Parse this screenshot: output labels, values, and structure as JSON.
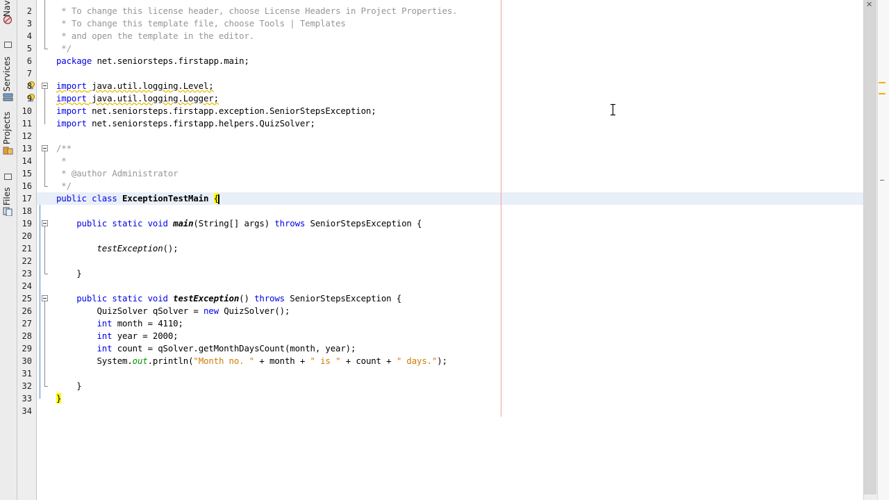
{
  "sidebar": {
    "tabs": [
      {
        "label": "Navigator"
      },
      {
        "label": "Services"
      },
      {
        "label": "Projects"
      },
      {
        "label": "Files"
      }
    ]
  },
  "editor": {
    "current_line": 17,
    "lines": [
      {
        "n": "2",
        "segs": [
          {
            "t": " * To change this license header, choose License Headers in Project Properties.",
            "c": "cm"
          }
        ]
      },
      {
        "n": "3",
        "segs": [
          {
            "t": " * To change this template file, choose Tools | Templates",
            "c": "cm"
          }
        ]
      },
      {
        "n": "4",
        "segs": [
          {
            "t": " * and open the template in the editor.",
            "c": "cm"
          }
        ]
      },
      {
        "n": "5",
        "segs": [
          {
            "t": " */",
            "c": "cm"
          }
        ]
      },
      {
        "n": "6",
        "segs": [
          {
            "t": "package",
            "c": "kw"
          },
          {
            "t": " net.seniorsteps.firstapp.main;",
            "c": ""
          }
        ]
      },
      {
        "n": "7",
        "segs": []
      },
      {
        "n": "8",
        "segs": [
          {
            "t": "import",
            "c": "kw warnul"
          },
          {
            "t": " java.util.logging.Level;",
            "c": "warnul"
          }
        ]
      },
      {
        "n": "9",
        "segs": [
          {
            "t": "import",
            "c": "kw warnul"
          },
          {
            "t": " java.util.logging.Logger;",
            "c": "warnul"
          }
        ]
      },
      {
        "n": "10",
        "segs": [
          {
            "t": "import",
            "c": "kw"
          },
          {
            "t": " net.seniorsteps.firstapp.exception.SeniorStepsException;",
            "c": ""
          }
        ]
      },
      {
        "n": "11",
        "segs": [
          {
            "t": "import",
            "c": "kw"
          },
          {
            "t": " net.seniorsteps.firstapp.helpers.QuizSolver;",
            "c": ""
          }
        ]
      },
      {
        "n": "12",
        "segs": []
      },
      {
        "n": "13",
        "segs": [
          {
            "t": "/**",
            "c": "cm"
          }
        ]
      },
      {
        "n": "14",
        "segs": [
          {
            "t": " *",
            "c": "cm"
          }
        ]
      },
      {
        "n": "15",
        "segs": [
          {
            "t": " * @author Administrator",
            "c": "cm"
          }
        ]
      },
      {
        "n": "16",
        "segs": [
          {
            "t": " */",
            "c": "cm"
          }
        ]
      },
      {
        "n": "17",
        "segs": [
          {
            "t": "public class",
            "c": "kw"
          },
          {
            "t": " ",
            "c": ""
          },
          {
            "t": "ExceptionTestMain",
            "c": "bold"
          },
          {
            "t": " ",
            "c": ""
          },
          {
            "t": "{",
            "c": "brace-hl"
          },
          {
            "caret": true
          }
        ]
      },
      {
        "n": "18",
        "segs": []
      },
      {
        "n": "19",
        "segs": [
          {
            "t": "    public static void",
            "c": "kw"
          },
          {
            "t": " ",
            "c": ""
          },
          {
            "t": "main",
            "c": "it bold"
          },
          {
            "t": "(String[] args) ",
            "c": ""
          },
          {
            "t": "throws",
            "c": "kw"
          },
          {
            "t": " SeniorStepsException {",
            "c": ""
          }
        ]
      },
      {
        "n": "20",
        "segs": []
      },
      {
        "n": "21",
        "segs": [
          {
            "t": "        ",
            "c": ""
          },
          {
            "t": "testException",
            "c": "it"
          },
          {
            "t": "();",
            "c": ""
          }
        ]
      },
      {
        "n": "22",
        "segs": []
      },
      {
        "n": "23",
        "segs": [
          {
            "t": "    }",
            "c": ""
          }
        ]
      },
      {
        "n": "24",
        "segs": []
      },
      {
        "n": "25",
        "segs": [
          {
            "t": "    public static void",
            "c": "kw"
          },
          {
            "t": " ",
            "c": ""
          },
          {
            "t": "testException",
            "c": "it bold"
          },
          {
            "t": "() ",
            "c": ""
          },
          {
            "t": "throws",
            "c": "kw"
          },
          {
            "t": " SeniorStepsException {",
            "c": ""
          }
        ]
      },
      {
        "n": "26",
        "segs": [
          {
            "t": "        QuizSolver qSolver = ",
            "c": ""
          },
          {
            "t": "new",
            "c": "kw"
          },
          {
            "t": " QuizSolver();",
            "c": ""
          }
        ]
      },
      {
        "n": "27",
        "segs": [
          {
            "t": "        ",
            "c": ""
          },
          {
            "t": "int",
            "c": "kw"
          },
          {
            "t": " month = 4110;",
            "c": ""
          }
        ]
      },
      {
        "n": "28",
        "segs": [
          {
            "t": "        ",
            "c": ""
          },
          {
            "t": "int",
            "c": "kw"
          },
          {
            "t": " year = 2000;",
            "c": ""
          }
        ]
      },
      {
        "n": "29",
        "segs": [
          {
            "t": "        ",
            "c": ""
          },
          {
            "t": "int",
            "c": "kw"
          },
          {
            "t": " count = qSolver.getMonthDaysCount(month, year);",
            "c": ""
          }
        ]
      },
      {
        "n": "30",
        "segs": [
          {
            "t": "        System.",
            "c": ""
          },
          {
            "t": "out",
            "c": "fld it"
          },
          {
            "t": ".println(",
            "c": ""
          },
          {
            "t": "\"Month no. \"",
            "c": "str"
          },
          {
            "t": " + month + ",
            "c": ""
          },
          {
            "t": "\" is \"",
            "c": "str"
          },
          {
            "t": " + count + ",
            "c": ""
          },
          {
            "t": "\" days.\"",
            "c": "str"
          },
          {
            "t": ");",
            "c": ""
          }
        ]
      },
      {
        "n": "31",
        "segs": []
      },
      {
        "n": "32",
        "segs": [
          {
            "t": "    }",
            "c": ""
          }
        ]
      },
      {
        "n": "33",
        "segs": [
          {
            "t": "}",
            "c": "brace-hl"
          }
        ]
      },
      {
        "n": "34",
        "segs": []
      }
    ]
  }
}
